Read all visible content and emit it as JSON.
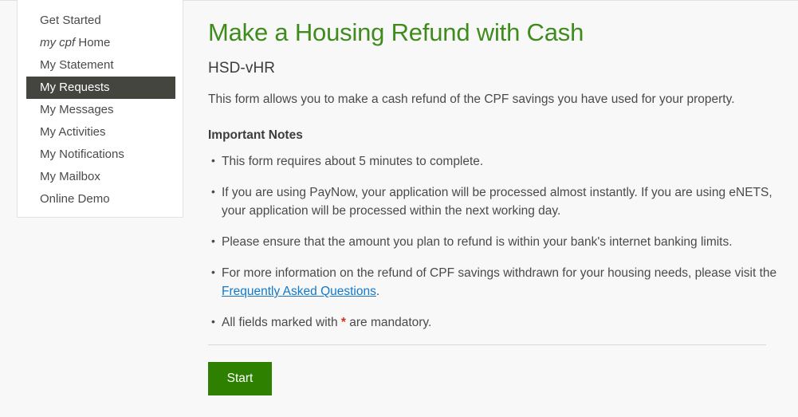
{
  "sidebar": {
    "items": [
      {
        "label": "Get Started",
        "active": false,
        "italic_prefix": ""
      },
      {
        "label": "Home",
        "active": false,
        "italic_prefix": "my cpf"
      },
      {
        "label": "My Statement",
        "active": false,
        "italic_prefix": ""
      },
      {
        "label": "My Requests",
        "active": true,
        "italic_prefix": ""
      },
      {
        "label": "My Messages",
        "active": false,
        "italic_prefix": ""
      },
      {
        "label": "My Activities",
        "active": false,
        "italic_prefix": ""
      },
      {
        "label": "My Notifications",
        "active": false,
        "italic_prefix": ""
      },
      {
        "label": "My Mailbox",
        "active": false,
        "italic_prefix": ""
      },
      {
        "label": "Online Demo",
        "active": false,
        "italic_prefix": ""
      }
    ]
  },
  "main": {
    "title": "Make a Housing Refund with Cash",
    "form_code": "HSD-vHR",
    "intro": "This form allows you to make a cash refund of the CPF savings you have used for your property.",
    "notes_heading": "Important Notes",
    "notes": [
      {
        "text": "This form requires about 5 minutes to complete."
      },
      {
        "text": "If you are using PayNow, your application will be processed almost instantly. If you are using eNETS, your application will be processed within the next working day."
      },
      {
        "text": "Please ensure that the amount you plan to refund is within your bank's internet banking limits."
      },
      {
        "text_before": "For more information on the refund of CPF savings withdrawn for your housing needs, please visit the ",
        "link_text": "Frequently Asked Questions",
        "text_after": "."
      },
      {
        "text_before": "All fields marked with ",
        "star": "*",
        "text_after": " are mandatory."
      }
    ],
    "start_label": "Start"
  },
  "colors": {
    "title_green": "#3f8c1d",
    "button_green": "#2e8000",
    "link_blue": "#1478c8",
    "required_red": "#d1321f",
    "active_nav_bg": "#454540",
    "page_bg": "#f8f8f8"
  }
}
